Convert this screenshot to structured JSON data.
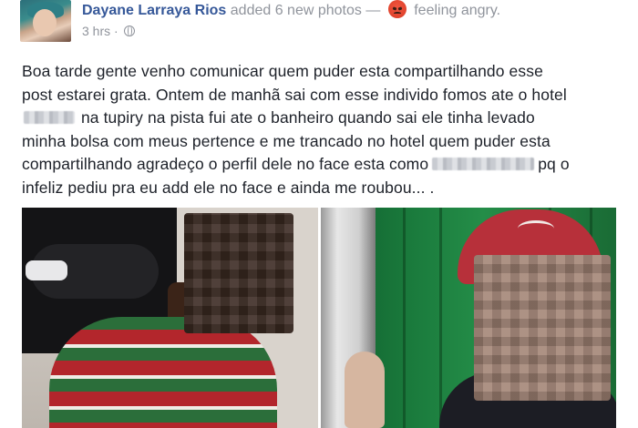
{
  "header": {
    "author": "Dayane Larraya Rios",
    "action": "added 6 new photos —",
    "feeling": "feeling angry.",
    "timestamp": "3 hrs",
    "separator": "·",
    "feeling_icon": "angry-face-icon",
    "privacy_icon": "globe-icon"
  },
  "post": {
    "lines": [
      "Boa tarde gente venho comunicar quem puder esta compartilhando esse",
      "post estarei grata. Ontem de manhã sai com esse individo fomos ate o hotel",
      "na tupiry na pista fui ate o banheiro quando sai ele tinha levado",
      "minha bolsa com meus pertence e me trancado no hotel quem puder esta",
      "compartilhando agradeço o perfil dele no face esta como",
      "pq o",
      "infeliz pediu pra eu add ele no face e ainda me roubou... ."
    ]
  },
  "colors": {
    "link": "#365899",
    "secondary": "#90949c",
    "text": "#1d2129",
    "angry": "#e0432d"
  }
}
